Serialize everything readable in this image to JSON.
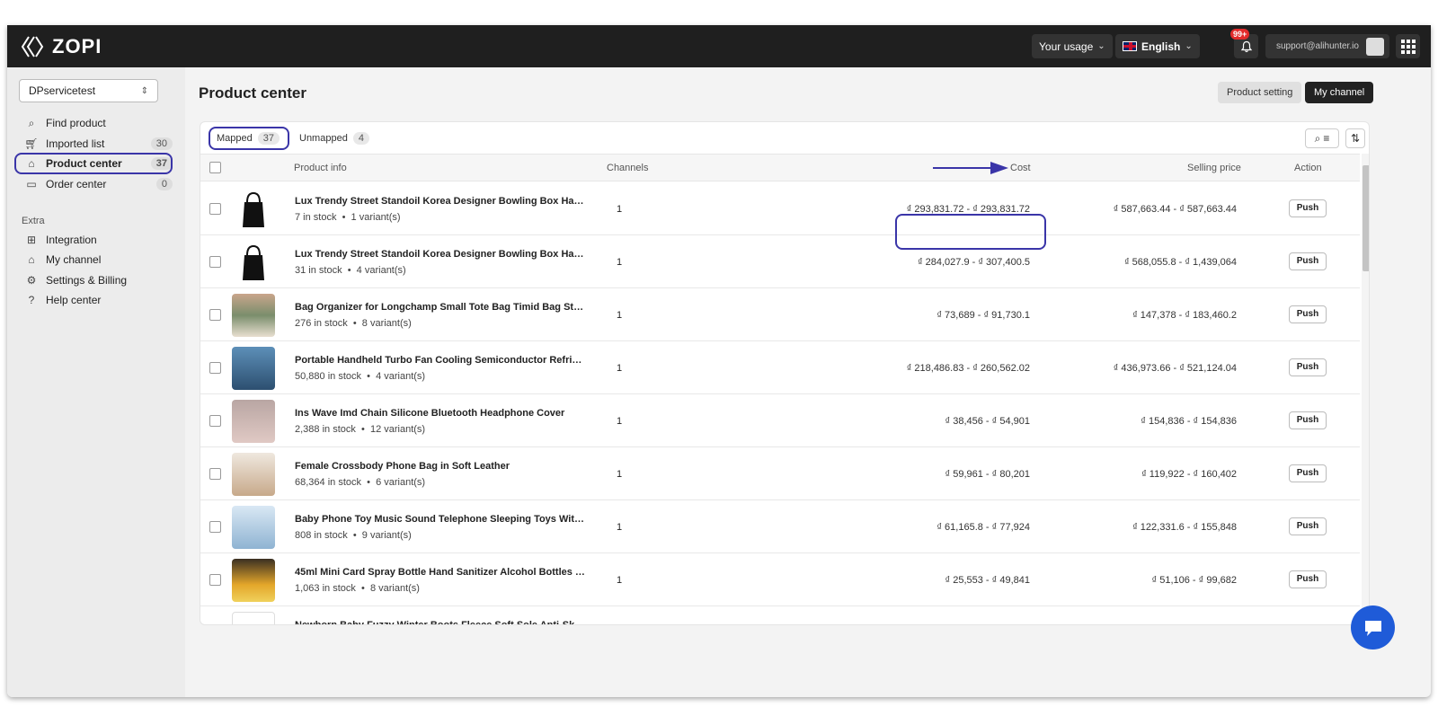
{
  "app": {
    "name": "ZOPI"
  },
  "topbar": {
    "usage_label": "Your usage",
    "language_label": "English",
    "notifications_count": "99+",
    "account_email": "support@alihunter.io"
  },
  "sidebar": {
    "store_name": "DPservicetest",
    "items": [
      {
        "label": "Find product",
        "count": ""
      },
      {
        "label": "Imported list",
        "count": "30"
      },
      {
        "label": "Product center",
        "count": "37"
      },
      {
        "label": "Order center",
        "count": "0"
      }
    ],
    "extra_label": "Extra",
    "extra_items": [
      {
        "label": "Integration"
      },
      {
        "label": "My channel"
      },
      {
        "label": "Settings & Billing"
      },
      {
        "label": "Help center"
      }
    ]
  },
  "main": {
    "title": "Product center",
    "product_setting_label": "Product setting",
    "my_channel_label": "My channel",
    "tabs": [
      {
        "label": "Mapped",
        "count": "37"
      },
      {
        "label": "Unmapped",
        "count": "4"
      }
    ],
    "columns": {
      "product_info": "Product info",
      "channels": "Channels",
      "cost": "Cost",
      "selling_price": "Selling price",
      "action": "Action"
    },
    "push_label": "Push",
    "rows": [
      {
        "name": "Lux Trendy Street Standoil Korea Designer Bowling Box Hand...",
        "stock": "7 in stock",
        "variants": "1 variant(s)",
        "channels": "1",
        "cost": "₫ 293,831.72 - ₫ 293,831.72",
        "price": "₫ 587,663.44 - ₫ 587,663.44"
      },
      {
        "name": "Lux Trendy Street Standoil Korea Designer Bowling Box Hand...",
        "stock": "31 in stock",
        "variants": "4 variant(s)",
        "channels": "1",
        "cost": "₫ 284,027.9 - ₫ 307,400.5",
        "price": "₫ 568,055.8 - ₫ 1,439,064"
      },
      {
        "name": "Bag Organizer for Longchamp Small Tote Bag Timid Bag Stora...",
        "stock": "276 in stock",
        "variants": "8 variant(s)",
        "channels": "1",
        "cost": "₫ 73,689 - ₫ 91,730.1",
        "price": "₫ 147,378 - ₫ 183,460.2"
      },
      {
        "name": "Portable Handheld Turbo Fan Cooling Semiconductor Refrige...",
        "stock": "50,880 in stock",
        "variants": "4 variant(s)",
        "channels": "1",
        "cost": "₫ 218,486.83 - ₫ 260,562.02",
        "price": "₫ 436,973.66 - ₫ 521,124.04"
      },
      {
        "name": "Ins Wave Imd Chain Silicone Bluetooth Headphone Cover",
        "stock": "2,388 in stock",
        "variants": "12 variant(s)",
        "channels": "1",
        "cost": "₫ 38,456 - ₫ 54,901",
        "price": "₫ 154,836 - ₫ 154,836"
      },
      {
        "name": "Female Crossbody Phone Bag in Soft Leather",
        "stock": "68,364 in stock",
        "variants": "6 variant(s)",
        "channels": "1",
        "cost": "₫ 59,961 - ₫ 80,201",
        "price": "₫ 119,922 - ₫ 160,402"
      },
      {
        "name": "Baby Phone Toy Music Sound Telephone Sleeping Toys With ...",
        "stock": "808 in stock",
        "variants": "9 variant(s)",
        "channels": "1",
        "cost": "₫ 61,165.8 - ₫ 77,924",
        "price": "₫ 122,331.6 - ₫ 155,848"
      },
      {
        "name": "45ml Mini Card Spray Bottle Hand Sanitizer Alcohol Bottles R...",
        "stock": "1,063 in stock",
        "variants": "8 variant(s)",
        "channels": "1",
        "cost": "₫ 25,553 - ₫ 49,841",
        "price": "₫ 51,106 - ₫ 99,682"
      },
      {
        "name": "Newborn Baby Fuzzy Winter Boots Fleece Soft Sole Anti-Skid...",
        "stock": "",
        "variants": "",
        "channels": "",
        "cost": "",
        "price": ""
      }
    ]
  },
  "colors": {
    "accent": "#3a35a8",
    "topbar": "#1f1f1f",
    "chat": "#1f5bd8",
    "badge": "#e32b2b"
  }
}
